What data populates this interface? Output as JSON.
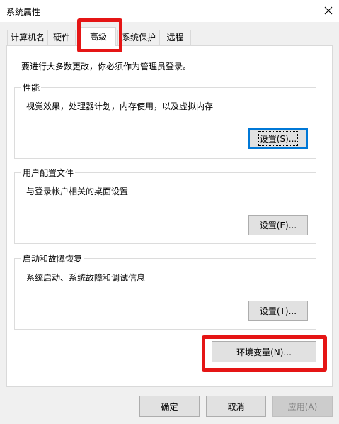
{
  "window": {
    "title": "系统属性"
  },
  "tabs": [
    {
      "label": "计算机名"
    },
    {
      "label": "硬件"
    },
    {
      "label": "高级"
    },
    {
      "label": "系统保护"
    },
    {
      "label": "远程"
    }
  ],
  "notice": "要进行大多数更改，你必须作为管理员登录。",
  "groups": {
    "performance": {
      "title": "性能",
      "desc": "视觉效果，处理器计划，内存使用，以及虚拟内存",
      "button": "设置(S)..."
    },
    "profiles": {
      "title": "用户配置文件",
      "desc": "与登录帐户相关的桌面设置",
      "button": "设置(E)..."
    },
    "startup": {
      "title": "启动和故障恢复",
      "desc": "系统启动、系统故障和调试信息",
      "button": "设置(T)..."
    }
  },
  "env_button": "环境变量(N)...",
  "dialog_buttons": {
    "ok": "确定",
    "cancel": "取消",
    "apply": "应用(A)"
  },
  "colors": {
    "highlight": "#e51515",
    "focus": "#0078d7"
  }
}
